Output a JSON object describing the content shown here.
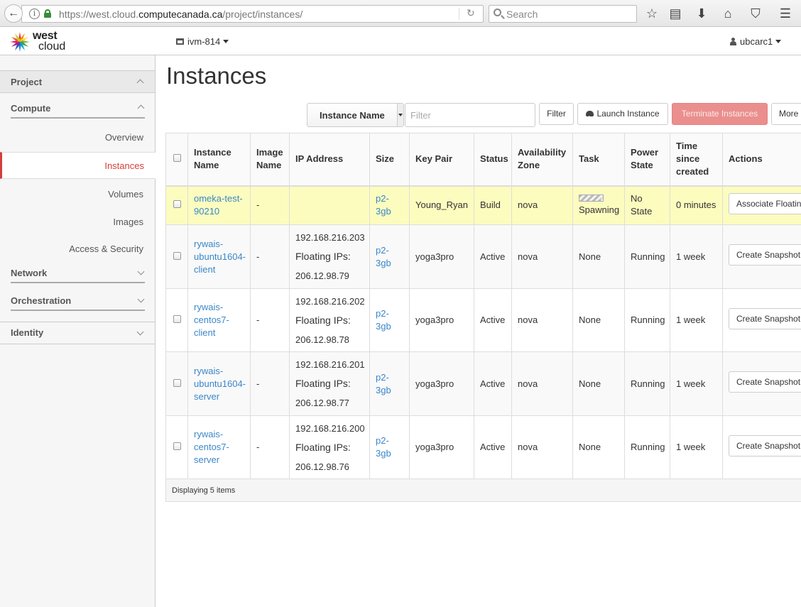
{
  "browser": {
    "url_prefix": "https://west.cloud.",
    "url_host": "computecanada.ca",
    "url_path": "/project/instances/",
    "search_placeholder": "Search"
  },
  "header": {
    "logo_top": "west",
    "logo_bottom": "cloud",
    "project": "ivm-814",
    "user": "ubcarc1"
  },
  "sidebar": {
    "project": "Project",
    "compute": "Compute",
    "items": [
      "Overview",
      "Instances",
      "Volumes",
      "Images",
      "Access & Security"
    ],
    "network": "Network",
    "orchestration": "Orchestration",
    "identity": "Identity"
  },
  "main": {
    "title": "Instances",
    "filter_field": "Instance Name",
    "filter_placeholder": "Filter",
    "filter_button": "Filter",
    "launch_button": "Launch Instance",
    "terminate_button": "Terminate Instances",
    "more_button": "More"
  },
  "table": {
    "headers": [
      "Instance Name",
      "Image Name",
      "IP Address",
      "Size",
      "Key Pair",
      "Status",
      "Availability Zone",
      "Task",
      "Power State",
      "Time since created",
      "Actions"
    ],
    "rows": [
      {
        "name": "omeka-test-90210",
        "image": "-",
        "ip": "",
        "floating_label": "",
        "floating": "",
        "size": "p2-3gb",
        "keypair": "Young_Ryan",
        "status": "Build",
        "zone": "nova",
        "task": "Spawning",
        "task_progress": 0.9,
        "power": "No State",
        "time": "0 minutes",
        "action": "Associate Floating IP"
      },
      {
        "name": "rywais-ubuntu1604-client",
        "image": "-",
        "ip": "192.168.216.203",
        "floating_label": "Floating IPs:",
        "floating": "206.12.98.79",
        "size": "p2-3gb",
        "keypair": "yoga3pro",
        "status": "Active",
        "zone": "nova",
        "task": "None",
        "power": "Running",
        "time": "1 week",
        "action": "Create Snapshot"
      },
      {
        "name": "rywais-centos7-client",
        "image": "-",
        "ip": "192.168.216.202",
        "floating_label": "Floating IPs:",
        "floating": "206.12.98.78",
        "size": "p2-3gb",
        "keypair": "yoga3pro",
        "status": "Active",
        "zone": "nova",
        "task": "None",
        "power": "Running",
        "time": "1 week",
        "action": "Create Snapshot"
      },
      {
        "name": "rywais-ubuntu1604-server",
        "image": "-",
        "ip": "192.168.216.201",
        "floating_label": "Floating IPs:",
        "floating": "206.12.98.77",
        "size": "p2-3gb",
        "keypair": "yoga3pro",
        "status": "Active",
        "zone": "nova",
        "task": "None",
        "power": "Running",
        "time": "1 week",
        "action": "Create Snapshot"
      },
      {
        "name": "rywais-centos7-server",
        "image": "-",
        "ip": "192.168.216.200",
        "floating_label": "Floating IPs:",
        "floating": "206.12.98.76",
        "size": "p2-3gb",
        "keypair": "yoga3pro",
        "status": "Active",
        "zone": "nova",
        "task": "None",
        "power": "Running",
        "time": "1 week",
        "action": "Create Snapshot"
      }
    ],
    "footer": "Displaying 5 items"
  }
}
